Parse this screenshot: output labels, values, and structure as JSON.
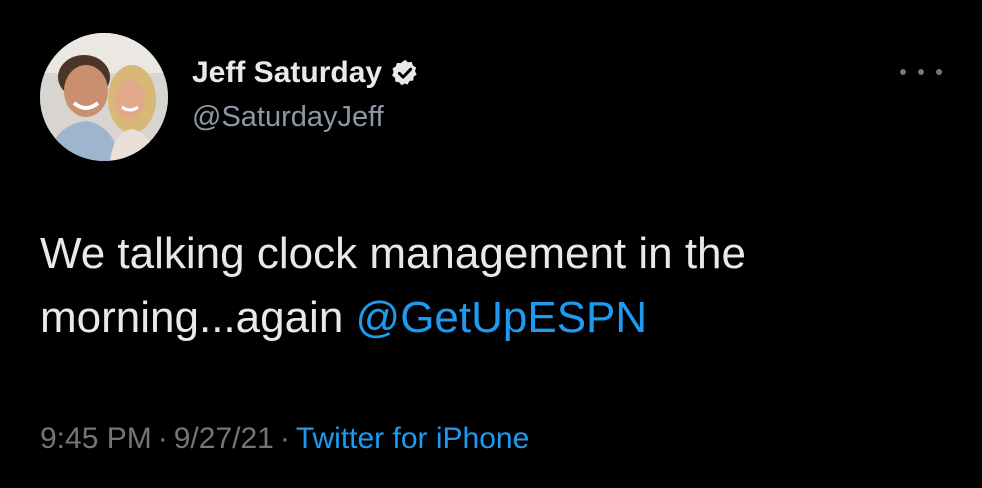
{
  "user": {
    "display_name": "Jeff Saturday",
    "handle": "@SaturdayJeff",
    "verified": true
  },
  "tweet": {
    "text_line1": "We talking clock management in the",
    "text_line2_prefix": "morning...again ",
    "mention": "@GetUpESPN",
    "time": "9:45 PM",
    "date": "9/27/21",
    "separator": "·",
    "source": "Twitter for iPhone"
  },
  "icons": {
    "verified": "verified-badge-icon",
    "more": "more-options-icon"
  },
  "colors": {
    "background": "#000000",
    "primary_text": "#e7e9ea",
    "secondary_text": "#71767b",
    "link": "#1d9bf0"
  }
}
